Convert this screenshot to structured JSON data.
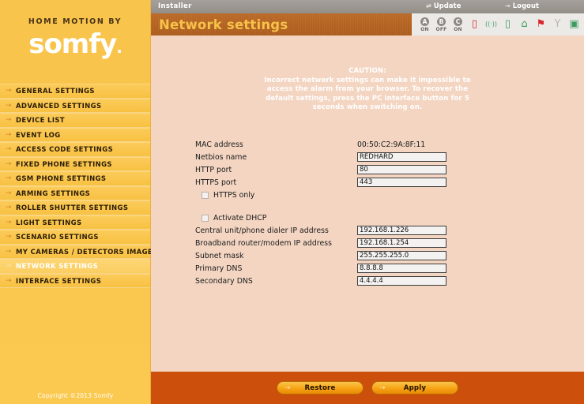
{
  "brand": {
    "tagline": "HOME MOTION BY",
    "name": "somfy",
    "dot": ".",
    "copyright": "Copyright ©2013 Somfy"
  },
  "topbar": {
    "user_role": "Installer",
    "update_label": "Update",
    "update_icon": "refresh-icon",
    "logout_label": "Logout",
    "logout_icon": "arrow-right-icon"
  },
  "header": {
    "title": "Network settings"
  },
  "status_icons": [
    {
      "name": "zone-a-indicator",
      "badge": "A",
      "label": "ON",
      "kind": "badge"
    },
    {
      "name": "zone-b-indicator",
      "badge": "B",
      "label": "OFF",
      "kind": "badge"
    },
    {
      "name": "zone-c-indicator",
      "badge": "C",
      "label": "ON",
      "kind": "badge"
    },
    {
      "name": "battery-icon",
      "glyph": "▯",
      "color_class": "g-red",
      "kind": "glyph"
    },
    {
      "name": "radio-signal-icon",
      "glyph": "((·))",
      "color_class": "g-green",
      "kind": "glyph"
    },
    {
      "name": "mobile-device-icon",
      "glyph": "▯",
      "color_class": "g-green",
      "kind": "glyph"
    },
    {
      "name": "home-icon",
      "glyph": "⌂",
      "color_class": "g-green",
      "kind": "glyph"
    },
    {
      "name": "alarm-flag-icon",
      "glyph": "⚑",
      "color_class": "g-red",
      "kind": "glyph"
    },
    {
      "name": "antenna-icon",
      "glyph": "Y",
      "color_class": "g-gray",
      "kind": "glyph"
    },
    {
      "name": "sd-card-icon",
      "glyph": "▣",
      "color_class": "g-green",
      "kind": "glyph"
    }
  ],
  "sidebar": {
    "items": [
      {
        "label": "General settings",
        "active": false
      },
      {
        "label": "Advanced settings",
        "active": false
      },
      {
        "label": "Device list",
        "active": false
      },
      {
        "label": "Event log",
        "active": false
      },
      {
        "label": "Access code settings",
        "active": false
      },
      {
        "label": "Fixed phone settings",
        "active": false
      },
      {
        "label": "GSM phone settings",
        "active": false
      },
      {
        "label": "Arming settings",
        "active": false
      },
      {
        "label": "Roller shutter settings",
        "active": false
      },
      {
        "label": "Light settings",
        "active": false
      },
      {
        "label": "Scenario settings",
        "active": false
      },
      {
        "label": "My cameras / detectors images",
        "active": false
      },
      {
        "label": "Network settings",
        "active": true
      },
      {
        "label": "Interface settings",
        "active": false
      }
    ]
  },
  "caution": {
    "title": "CAUTION:",
    "line1": "Incorrect network settings can make it impossible to",
    "line2": "access the alarm from your browser. To recover the",
    "line3": "default settings, press the PC interface button for 5",
    "line4": "seconds when switching on."
  },
  "form": {
    "mac_address": {
      "label": "MAC address",
      "value": "00:50:C2:9A:8F:11"
    },
    "netbios_name": {
      "label": "Netbios name",
      "value": "REDHARD"
    },
    "http_port": {
      "label": "HTTP port",
      "value": "80"
    },
    "https_port": {
      "label": "HTTPS port",
      "value": "443"
    },
    "https_only": {
      "label": "HTTPS only",
      "checked": false
    },
    "activate_dhcp": {
      "label": "Activate DHCP",
      "checked": false
    },
    "central_unit_ip": {
      "label": "Central unit/phone dialer IP address",
      "value": "192.168.1.226"
    },
    "router_ip": {
      "label": "Broadband router/modem IP address",
      "value": "192.168.1.254"
    },
    "subnet_mask": {
      "label": "Subnet mask",
      "value": "255.255.255.0"
    },
    "primary_dns": {
      "label": "Primary DNS",
      "value": "8.8.8.8"
    },
    "secondary_dns": {
      "label": "Secondary DNS",
      "value": "4.4.4.4"
    }
  },
  "footer": {
    "restore_label": "Restore",
    "apply_label": "Apply",
    "button_icon": "arrow-right-icon"
  },
  "colors": {
    "sidebar": "#f9c54d",
    "title_bar": "#ad5d1d",
    "title_text": "#f7c24a",
    "content_bg": "#f3d5c2",
    "footer_bg": "#cc4f0c",
    "button_orange": "#f6a415",
    "topbar_gray": "#948e88"
  }
}
